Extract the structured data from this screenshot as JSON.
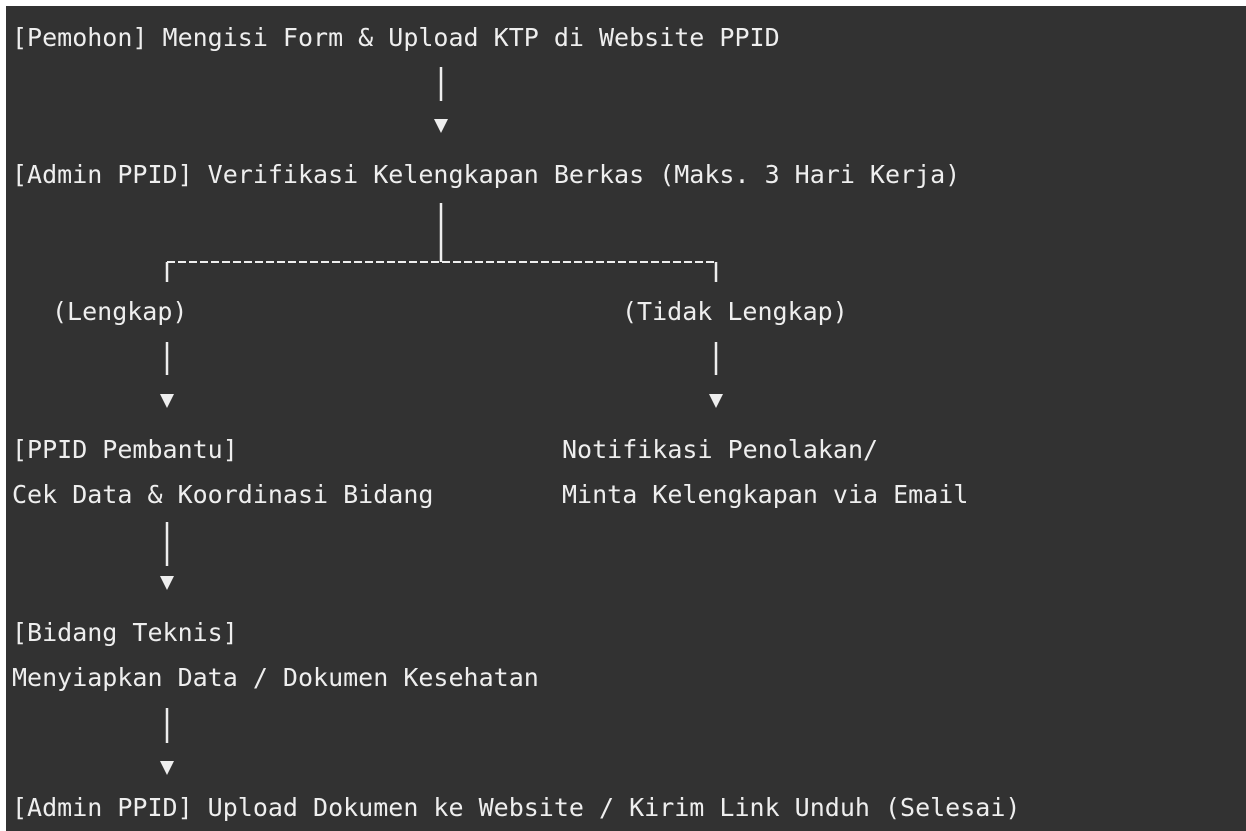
{
  "flowchart": {
    "step_submit": "[Pemohon] Mengisi Form & Upload KTP di Website PPID",
    "step_verify": "[Admin PPID] Verifikasi Kelengkapan Berkas (Maks. 3 Hari Kerja)",
    "branch_complete_label": "(Lengkap)",
    "branch_incomplete_label": "(Tidak Lengkap)",
    "step_ppid_pembantu_title": "[PPID Pembantu]",
    "step_ppid_pembantu_desc": "Cek Data & Koordinasi Bidang",
    "step_rejection_line1": "Notifikasi Penolakan/",
    "step_rejection_line2": "Minta Kelengkapan via Email",
    "step_bidang_title": "[Bidang Teknis]",
    "step_bidang_desc": "Menyiapkan Data / Dokumen Kesehatan",
    "step_final": "[Admin PPID] Upload Dokumen ke Website / Kirim Link Unduh (Selesai)"
  },
  "colors": {
    "background": "#323232",
    "text": "#eeeeee",
    "lines": "#eeeeee"
  }
}
